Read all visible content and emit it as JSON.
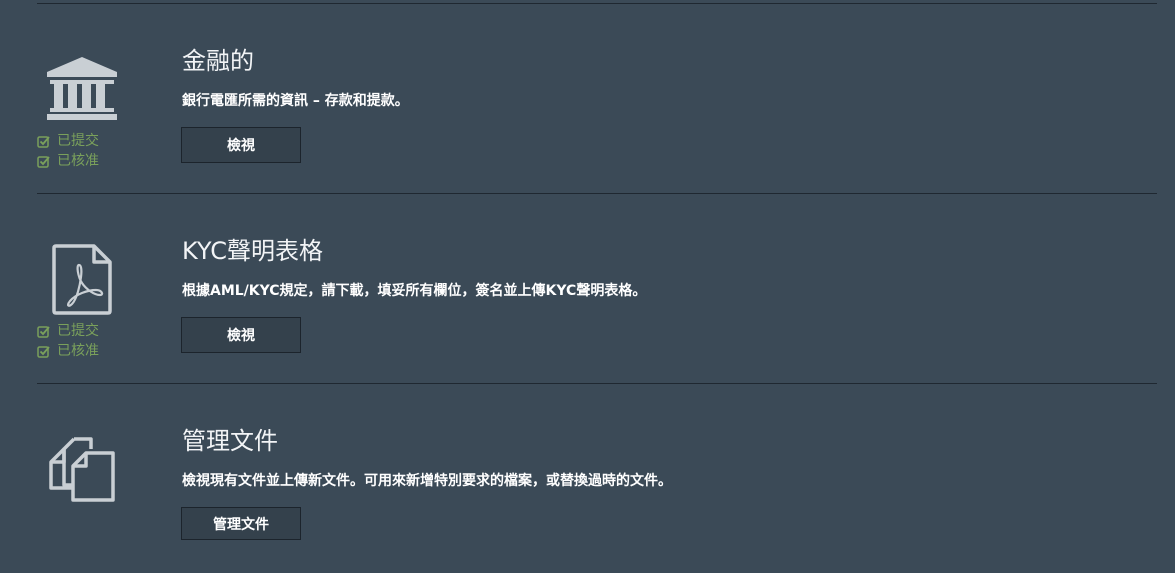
{
  "sections": [
    {
      "title": "金融的",
      "description": "銀行電匯所需的資訊 – 存款和提款。",
      "button_label": "檢視",
      "icon": "bank-icon",
      "statuses": [
        "已提交",
        "已核准"
      ]
    },
    {
      "title": "KYC聲明表格",
      "description": "根據AML/KYC規定，請下載，填妥所有欄位，簽名並上傳KYC聲明表格。",
      "button_label": "檢視",
      "icon": "pdf-document-icon",
      "statuses": [
        "已提交",
        "已核准"
      ]
    },
    {
      "title": "管理文件",
      "description": "檢視現有文件並上傳新文件。可用來新增特別要求的檔案，或替換過時的文件。",
      "button_label": "管理文件",
      "icon": "documents-icon",
      "statuses": []
    }
  ],
  "colors": {
    "background": "#3b4a57",
    "status_green": "#7aa05b",
    "icon_grey": "#c9cfd4",
    "divider": "#1f2831"
  }
}
